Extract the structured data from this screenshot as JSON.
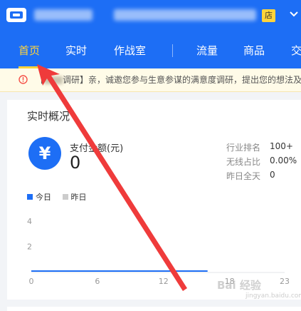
{
  "header": {
    "badge": "店",
    "nav": [
      {
        "label": "首页",
        "active": true
      },
      {
        "label": "实时",
        "active": false
      },
      {
        "label": "作战室",
        "active": false
      },
      {
        "label": "流量",
        "active": false
      },
      {
        "label": "商品",
        "active": false
      },
      {
        "label": "交",
        "active": false
      }
    ],
    "colors": {
      "bar": "#1d6ef5",
      "active": "#ffd43b"
    }
  },
  "notice": {
    "prefix": "【",
    "middle": "调研】亲，诚邀您参与生意参谋的满意度调研，提出您的想法及建议",
    "icon": "warning-icon"
  },
  "realtime": {
    "title": "实时概况",
    "metric": {
      "label": "支付金额(元)",
      "value": "0",
      "icon": "yen-icon"
    },
    "stats": [
      {
        "label": "行业排名",
        "value": "100+"
      },
      {
        "label": "无线占比",
        "value": "0.00%"
      },
      {
        "label": "昨日全天",
        "value": "0"
      }
    ],
    "legend": [
      {
        "label": "今日",
        "color": "#1d6ef5"
      },
      {
        "label": "昨日",
        "color": "#cccccc"
      }
    ]
  },
  "chart_data": {
    "type": "line",
    "x_ticks": [
      "0",
      "6",
      "12",
      "18",
      "23"
    ],
    "y_ticks": [
      "2",
      "4"
    ],
    "xlim": [
      0,
      23
    ],
    "ylim": [
      0,
      5
    ],
    "grid": false,
    "legend_position": "top-left",
    "series": [
      {
        "name": "今日",
        "color": "#1d6ef5",
        "x": [
          0,
          1,
          2,
          3,
          4,
          5,
          6,
          7,
          8,
          9,
          10,
          11,
          12,
          13,
          14,
          15,
          16
        ],
        "y": [
          0,
          0,
          0,
          0,
          0,
          0,
          0,
          0,
          0,
          0,
          0,
          0,
          0,
          0,
          0,
          0,
          0
        ]
      }
    ]
  },
  "watermark": {
    "main": "Bai 经验",
    "sub": "jingyan.baidu.com"
  }
}
